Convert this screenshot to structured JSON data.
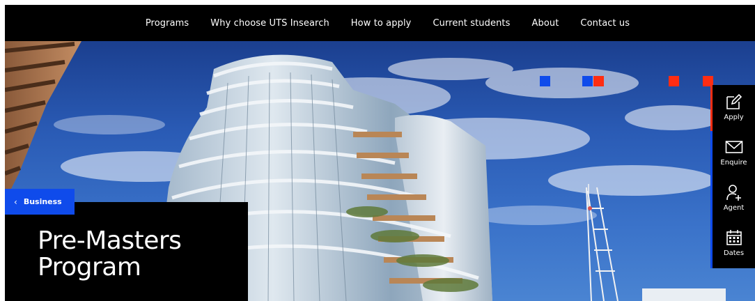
{
  "topnav": {
    "items": [
      "Programs",
      "Why choose UTS Insearch",
      "How to apply",
      "Current students",
      "About",
      "Contact us"
    ]
  },
  "hero": {
    "category_tag": "Business",
    "title_line1": "Pre-Masters",
    "title_line2": "Program"
  },
  "sidebar": {
    "items": [
      {
        "label": "Apply",
        "icon": "edit-icon"
      },
      {
        "label": "Enquire",
        "icon": "envelope-icon"
      },
      {
        "label": "Agent",
        "icon": "person-add-icon"
      },
      {
        "label": "Dates",
        "icon": "calendar-icon"
      }
    ]
  },
  "colors": {
    "accent_blue": "#0f4beb",
    "accent_red": "#ff2d12",
    "background": "#000000",
    "text": "#ffffff"
  }
}
